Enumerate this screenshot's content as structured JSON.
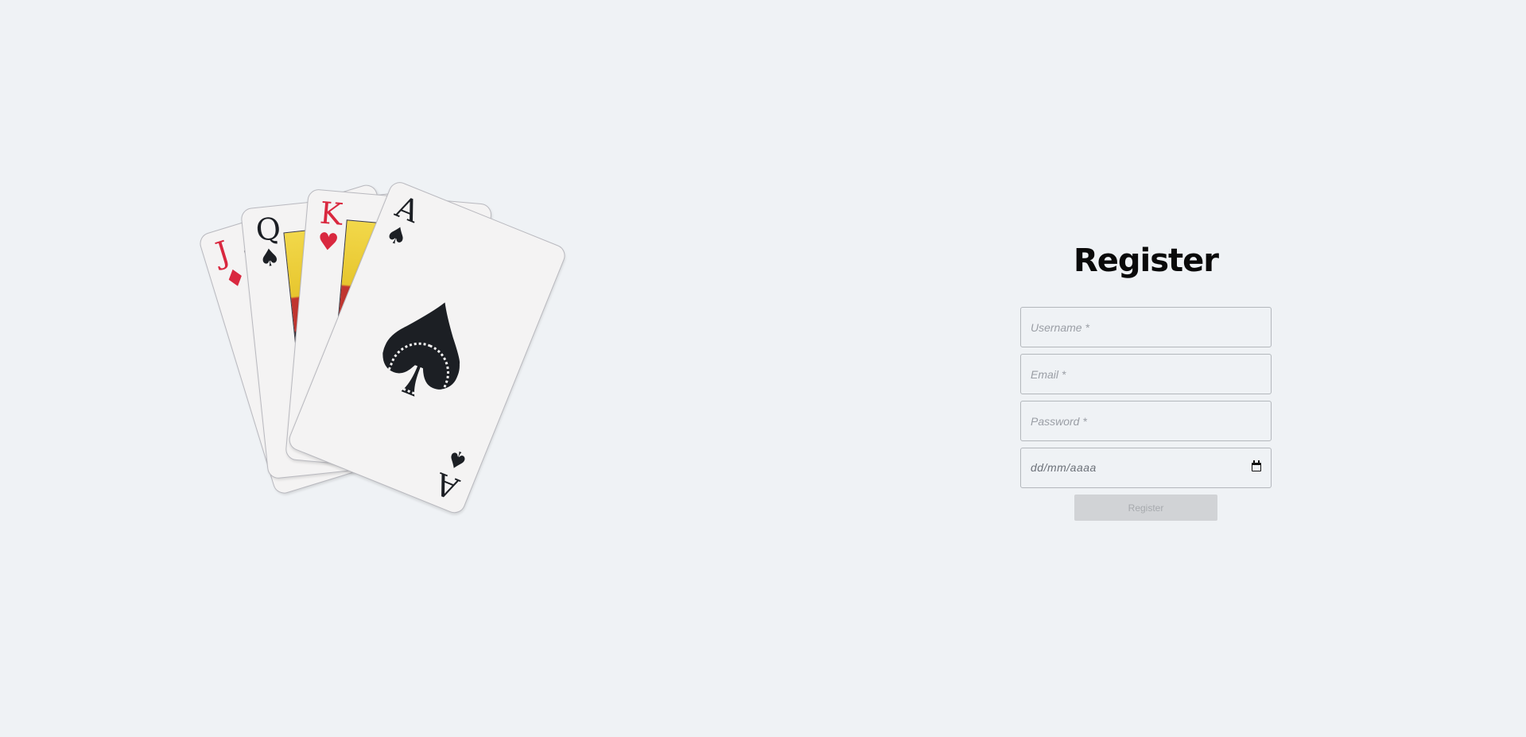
{
  "illustration": {
    "cards": [
      {
        "rank": "J",
        "suit": "♦",
        "color": "#d9283f"
      },
      {
        "rank": "Q",
        "suit": "♠",
        "color": "#1c1f24"
      },
      {
        "rank": "K",
        "suit": "♥",
        "color": "#d9283f"
      },
      {
        "rank": "A",
        "suit": "♠",
        "color": "#1c1f24"
      }
    ]
  },
  "form": {
    "title": "Register",
    "username": {
      "placeholder": "Username *",
      "value": ""
    },
    "email": {
      "placeholder": "Email *",
      "value": ""
    },
    "password": {
      "placeholder": "Password *",
      "value": ""
    },
    "birthdate": {
      "display": "dd/mm/aaaa",
      "icon": "calendar-icon"
    },
    "submit_label": "Register",
    "submit_disabled": true
  },
  "colors": {
    "background": "#eff2f5",
    "field_border": "#b3b7bc",
    "button_bg": "#d1d3d6",
    "button_text": "#a7aaae"
  }
}
